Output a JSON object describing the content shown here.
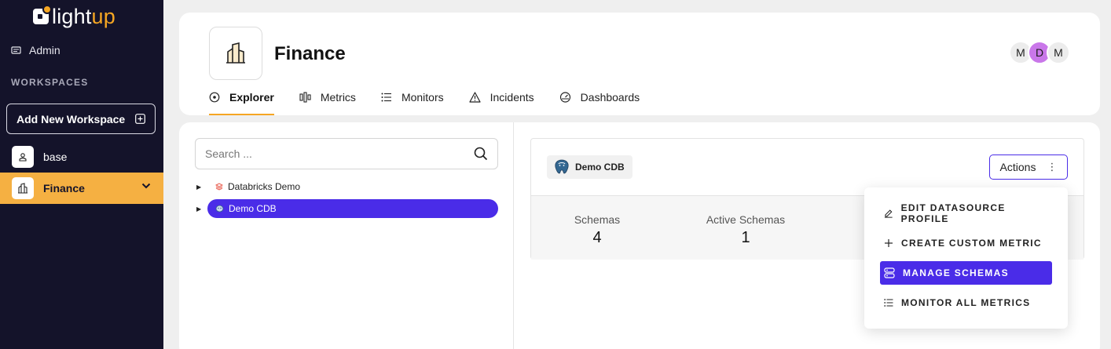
{
  "brand": {
    "name_main": "light",
    "name_accent": "up",
    "accent_color": "#f5a623",
    "sidebar_bg": "#14132a"
  },
  "sidebar": {
    "admin_label": "Admin",
    "section_title": "WORKSPACES",
    "add_workspace_label": "Add New Workspace",
    "workspaces": [
      {
        "label": "base",
        "selected": false
      },
      {
        "label": "Finance",
        "selected": true
      }
    ]
  },
  "header": {
    "workspace_title": "Finance",
    "avatars": [
      "M",
      "D",
      "M"
    ],
    "tabs": [
      {
        "label": "Explorer",
        "active": true,
        "icon": "explorer-icon"
      },
      {
        "label": "Metrics",
        "active": false,
        "icon": "metrics-icon"
      },
      {
        "label": "Monitors",
        "active": false,
        "icon": "monitors-icon"
      },
      {
        "label": "Incidents",
        "active": false,
        "icon": "incidents-icon"
      },
      {
        "label": "Dashboards",
        "active": false,
        "icon": "dashboards-icon"
      }
    ]
  },
  "explorer": {
    "search_placeholder": "Search ...",
    "tree": [
      {
        "label": "Databricks Demo",
        "selected": false
      },
      {
        "label": "Demo CDB",
        "selected": true
      }
    ]
  },
  "datasource": {
    "name": "Demo CDB",
    "actions_label": "Actions",
    "stats": [
      {
        "label": "Schemas",
        "value": "4"
      },
      {
        "label": "Active Schemas",
        "value": "1"
      }
    ]
  },
  "actions_menu": {
    "items": [
      {
        "label": "EDIT DATASOURCE PROFILE",
        "icon": "pencil-icon",
        "highlighted": false
      },
      {
        "label": "CREATE CUSTOM METRIC",
        "icon": "plus-icon",
        "highlighted": false
      },
      {
        "label": "MANAGE SCHEMAS",
        "icon": "schemas-icon",
        "highlighted": true
      },
      {
        "label": "MONITOR ALL METRICS",
        "icon": "list-icon",
        "highlighted": false
      }
    ]
  }
}
